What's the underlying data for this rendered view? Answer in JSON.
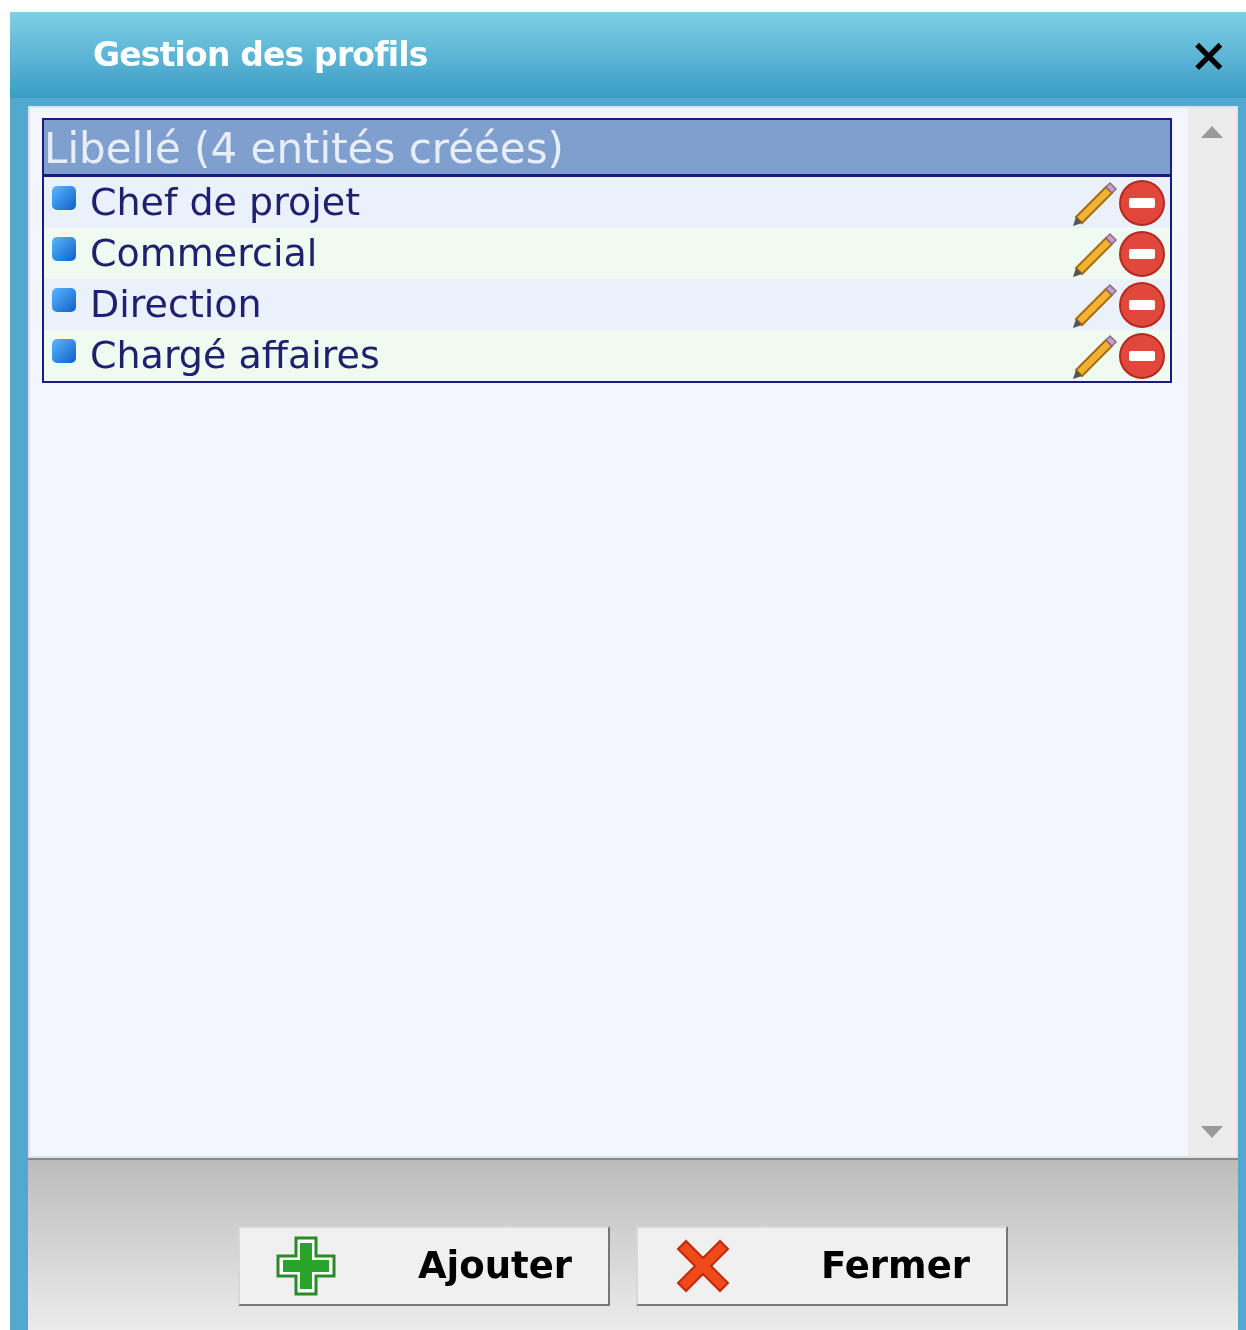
{
  "window": {
    "title": "Gestion des profils",
    "close": "×"
  },
  "table": {
    "header": "Libellé (4 entités créées)",
    "rows": [
      {
        "label": "Chef de projet"
      },
      {
        "label": "Commercial"
      },
      {
        "label": "Direction"
      },
      {
        "label": "Chargé affaires"
      }
    ]
  },
  "buttons": [
    {
      "kind": "add",
      "label": "Ajouter"
    },
    {
      "kind": "close",
      "label": "Fermer"
    }
  ]
}
